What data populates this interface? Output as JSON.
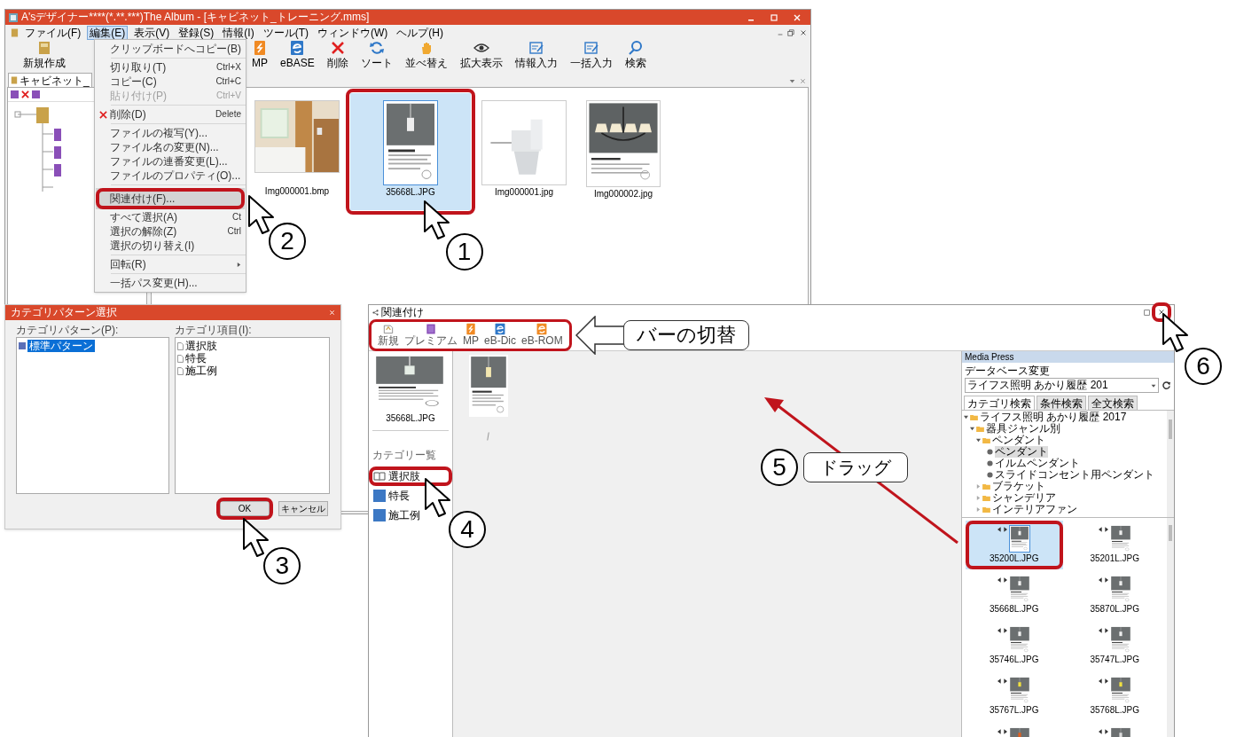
{
  "main_window": {
    "title": "A'sデザイナー****(*.**.***)The Album - [キャビネット_トレーニング.mms]",
    "menu": [
      {
        "label": "ファイル(F)",
        "selected": false
      },
      {
        "label": "編集(E)",
        "selected": true
      },
      {
        "label": "表示(V)",
        "selected": false
      },
      {
        "label": "登録(S)",
        "selected": false
      },
      {
        "label": "情報(I)",
        "selected": false
      },
      {
        "label": "ツール(T)",
        "selected": false
      },
      {
        "label": "ウィンドウ(W)",
        "selected": false
      },
      {
        "label": "ヘルプ(H)",
        "selected": false
      }
    ],
    "toolbar": [
      {
        "label": "新規作成"
      },
      {
        "label": "MP"
      },
      {
        "label": "eBASE"
      },
      {
        "label": "削除"
      },
      {
        "label": "ソート"
      },
      {
        "label": "並べ替え"
      },
      {
        "label": "拡大表示"
      },
      {
        "label": "情報入力"
      },
      {
        "label": "一括入力"
      },
      {
        "label": "検索"
      }
    ],
    "tab": "キャビネット_",
    "thumbnails": [
      {
        "label": "Img000001.bmp",
        "selected": false
      },
      {
        "label": "35668L.JPG",
        "selected": true
      },
      {
        "label": "Img000001.jpg",
        "selected": false
      },
      {
        "label": "Img000002.jpg",
        "selected": false
      }
    ]
  },
  "context_menu": [
    {
      "kind": "item",
      "label": "クリップボードへコピー(B)",
      "disabled": false,
      "selected": false
    },
    {
      "kind": "separator"
    },
    {
      "kind": "item",
      "label": "切り取り(T)",
      "shortcut": "Ctrl+X",
      "disabled": false,
      "selected": false
    },
    {
      "kind": "item",
      "label": "コピー(C)",
      "shortcut": "Ctrl+C",
      "disabled": false,
      "selected": false
    },
    {
      "kind": "item",
      "label": "貼り付け(P)",
      "shortcut": "Ctrl+V",
      "disabled": true,
      "selected": false
    },
    {
      "kind": "separator"
    },
    {
      "kind": "delete",
      "label": "削除(D)",
      "shortcut": "Delete",
      "disabled": false,
      "selected": false
    },
    {
      "kind": "separator"
    },
    {
      "kind": "item",
      "label": "ファイルの複写(Y)...",
      "disabled": false,
      "selected": false
    },
    {
      "kind": "item",
      "label": "ファイル名の変更(N)...",
      "disabled": false,
      "selected": false
    },
    {
      "kind": "item",
      "label": "ファイルの連番変更(L)...",
      "disabled": false,
      "selected": false
    },
    {
      "kind": "item",
      "label": "ファイルのプロパティ(O)...",
      "disabled": false,
      "selected": false
    },
    {
      "kind": "separator"
    },
    {
      "kind": "item",
      "label": "関連付け(F)...",
      "disabled": false,
      "selected": true
    },
    {
      "kind": "item",
      "label": "すべて選択(A)",
      "shortcut": "Ct",
      "disabled": false,
      "selected": false
    },
    {
      "kind": "item",
      "label": "選択の解除(Z)",
      "shortcut": "Ctrl",
      "disabled": false,
      "selected": false
    },
    {
      "kind": "item",
      "label": "選択の切り替え(I)",
      "disabled": false,
      "selected": false
    },
    {
      "kind": "separator"
    },
    {
      "kind": "submenu",
      "label": "回転(R)",
      "disabled": false,
      "selected": false
    },
    {
      "kind": "separator"
    },
    {
      "kind": "item",
      "label": "一括パス変更(H)...",
      "disabled": false,
      "selected": false
    }
  ],
  "category_dialog": {
    "title": "カテゴリパターン選択",
    "patterns_label": "カテゴリパターン(P):",
    "patterns": [
      {
        "label": "標準パターン",
        "selected": true
      }
    ],
    "items_label": "カテゴリ項目(I):",
    "items": [
      "選択肢",
      "特長",
      "施工例"
    ],
    "buttons": [
      "OK",
      "キャンセル"
    ]
  },
  "link_window": {
    "title": "関連付け",
    "toolbar": [
      {
        "label": "新規"
      },
      {
        "label": "プレミアム"
      },
      {
        "label": "MP"
      },
      {
        "label": "eB-Dic"
      },
      {
        "label": "eB-ROM"
      }
    ],
    "preview_label": "35668L.JPG",
    "category_heading": "カテゴリー覧",
    "categories": [
      {
        "label": "選択肢",
        "kind": "book"
      },
      {
        "label": "特長",
        "kind": "block"
      },
      {
        "label": "施工例",
        "kind": "block"
      }
    ]
  },
  "media_panel": {
    "title": "Media Press",
    "db_label": "データベース変更",
    "db_value": "ライフス照明 あかり履歴 201",
    "tabs": [
      {
        "label": "カテゴリ検索",
        "selected": true
      },
      {
        "label": "条件検索",
        "selected": false
      },
      {
        "label": "全文検索",
        "selected": false
      }
    ],
    "tree": [
      {
        "kind": "folder",
        "label": "ライフス照明 あかり履歴 2017",
        "expanded": true,
        "children": [
          {
            "kind": "folder",
            "label": "器具ジャンル別",
            "expanded": true,
            "children": [
              {
                "kind": "folder",
                "label": "ペンダント",
                "expanded": true,
                "children": [
                  {
                    "kind": "leaf",
                    "label": "ペンダント",
                    "selected": true
                  },
                  {
                    "kind": "leaf",
                    "label": "イルムペンダント",
                    "selected": false
                  },
                  {
                    "kind": "leaf",
                    "label": "スライドコンセント用ペンダント",
                    "selected": false
                  }
                ]
              },
              {
                "kind": "folder",
                "label": "ブラケット",
                "expanded": false
              },
              {
                "kind": "folder",
                "label": "シャンデリア",
                "expanded": false
              },
              {
                "kind": "folder",
                "label": "インテリアファン",
                "expanded": false
              }
            ]
          }
        ]
      }
    ],
    "thumbnails": [
      {
        "label": "35200L.JPG",
        "selected": true
      },
      {
        "label": "35201L.JPG",
        "selected": false
      },
      {
        "label": "35668L.JPG",
        "selected": false
      },
      {
        "label": "35870L.JPG",
        "selected": false
      },
      {
        "label": "35746L.JPG",
        "selected": false
      },
      {
        "label": "35747L.JPG",
        "selected": false
      },
      {
        "label": "35767L.JPG",
        "selected": false
      },
      {
        "label": "35768L.JPG",
        "selected": false
      },
      {
        "selected": false
      },
      {
        "selected": false
      }
    ]
  },
  "annotations": {
    "steps": [
      "1",
      "2",
      "3",
      "4",
      "5",
      "6"
    ],
    "callouts": [
      "バーの切替",
      "ドラッグ"
    ]
  }
}
